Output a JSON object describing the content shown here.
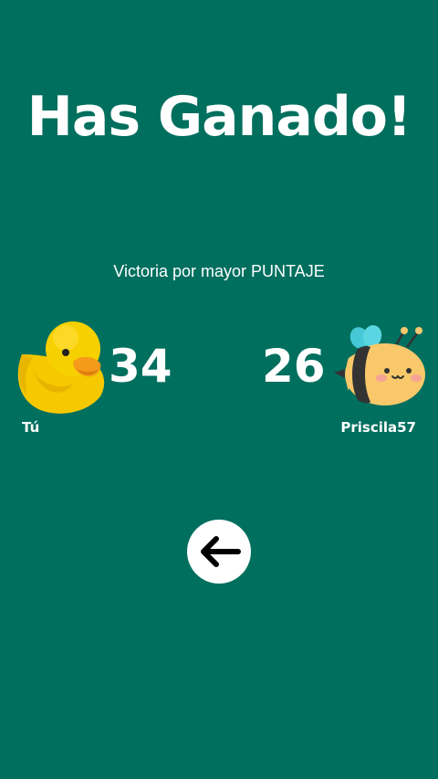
{
  "result": {
    "title": "Has Ganado!",
    "reason": "Victoria por mayor PUNTAJE"
  },
  "players": {
    "you": {
      "name": "Tú",
      "score": "34",
      "avatar": "duck-icon"
    },
    "opponent": {
      "name": "Priscila57",
      "score": "26",
      "avatar": "bee-icon"
    }
  },
  "actions": {
    "back_icon": "arrow-left-icon"
  },
  "colors": {
    "background": "#006f5e",
    "text": "#ffffff",
    "button": "#ffffff"
  }
}
